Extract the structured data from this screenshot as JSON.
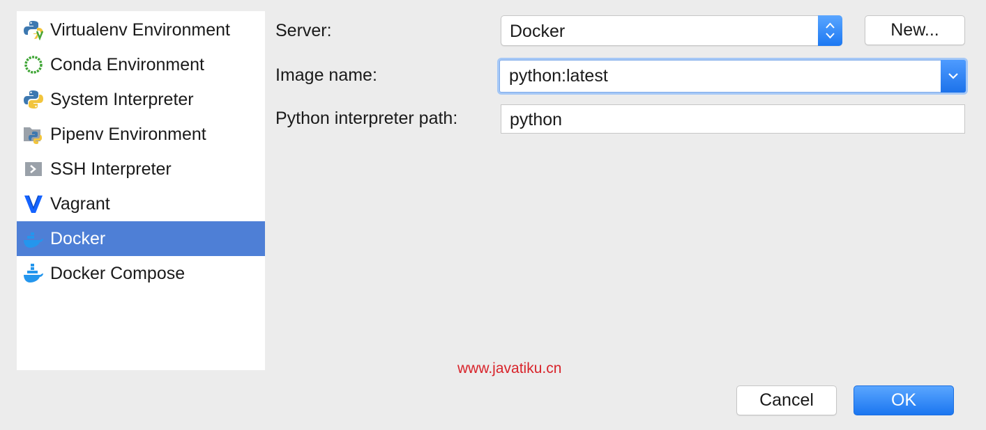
{
  "sidebar": {
    "items": [
      {
        "label": "Virtualenv Environment",
        "icon": "virtualenv-icon"
      },
      {
        "label": "Conda Environment",
        "icon": "conda-icon"
      },
      {
        "label": "System Interpreter",
        "icon": "python-icon"
      },
      {
        "label": "Pipenv Environment",
        "icon": "pipenv-icon"
      },
      {
        "label": "SSH Interpreter",
        "icon": "ssh-icon"
      },
      {
        "label": "Vagrant",
        "icon": "vagrant-icon"
      },
      {
        "label": "Docker",
        "icon": "docker-icon",
        "selected": true
      },
      {
        "label": "Docker Compose",
        "icon": "docker-compose-icon"
      }
    ]
  },
  "form": {
    "server_label": "Server:",
    "server_value": "Docker",
    "new_button": "New...",
    "image_label": "Image name:",
    "image_value": "python:latest",
    "path_label": "Python interpreter path:",
    "path_value": "python"
  },
  "watermark": "www.javatiku.cn",
  "buttons": {
    "cancel": "Cancel",
    "ok": "OK"
  },
  "colors": {
    "accent": "#1c78f2",
    "selection": "#4e7fd6",
    "watermark": "#d8232a"
  }
}
